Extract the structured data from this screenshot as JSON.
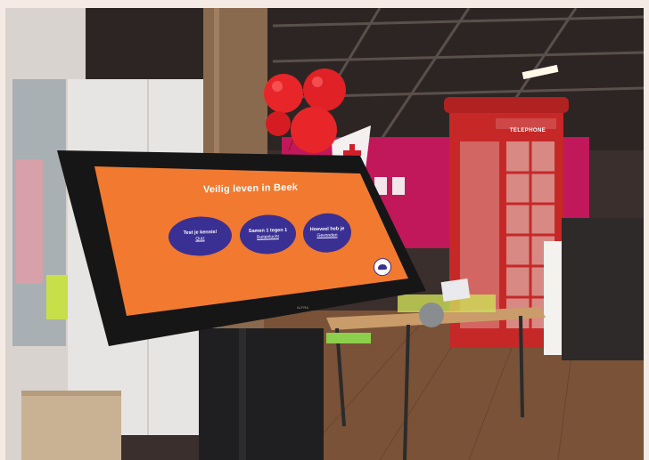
{
  "kiosk": {
    "title": "Veilig leven in Beek",
    "buttons": [
      {
        "label": "Test je kennis!",
        "sub": "Quiz"
      },
      {
        "label": "Samen 1 tegen 1",
        "sub": "Buitenlucht"
      },
      {
        "label": "Hoeveel heb je",
        "sub": "Gevonden"
      }
    ],
    "brand": "ALFRA"
  },
  "phone_booth": {
    "sign": "TELEPHONE"
  },
  "colors": {
    "screen": "#f17a30",
    "button": "#3a2f93",
    "booth": "#c62828",
    "wall": "#c0185a",
    "balloon": "#e8262a"
  }
}
